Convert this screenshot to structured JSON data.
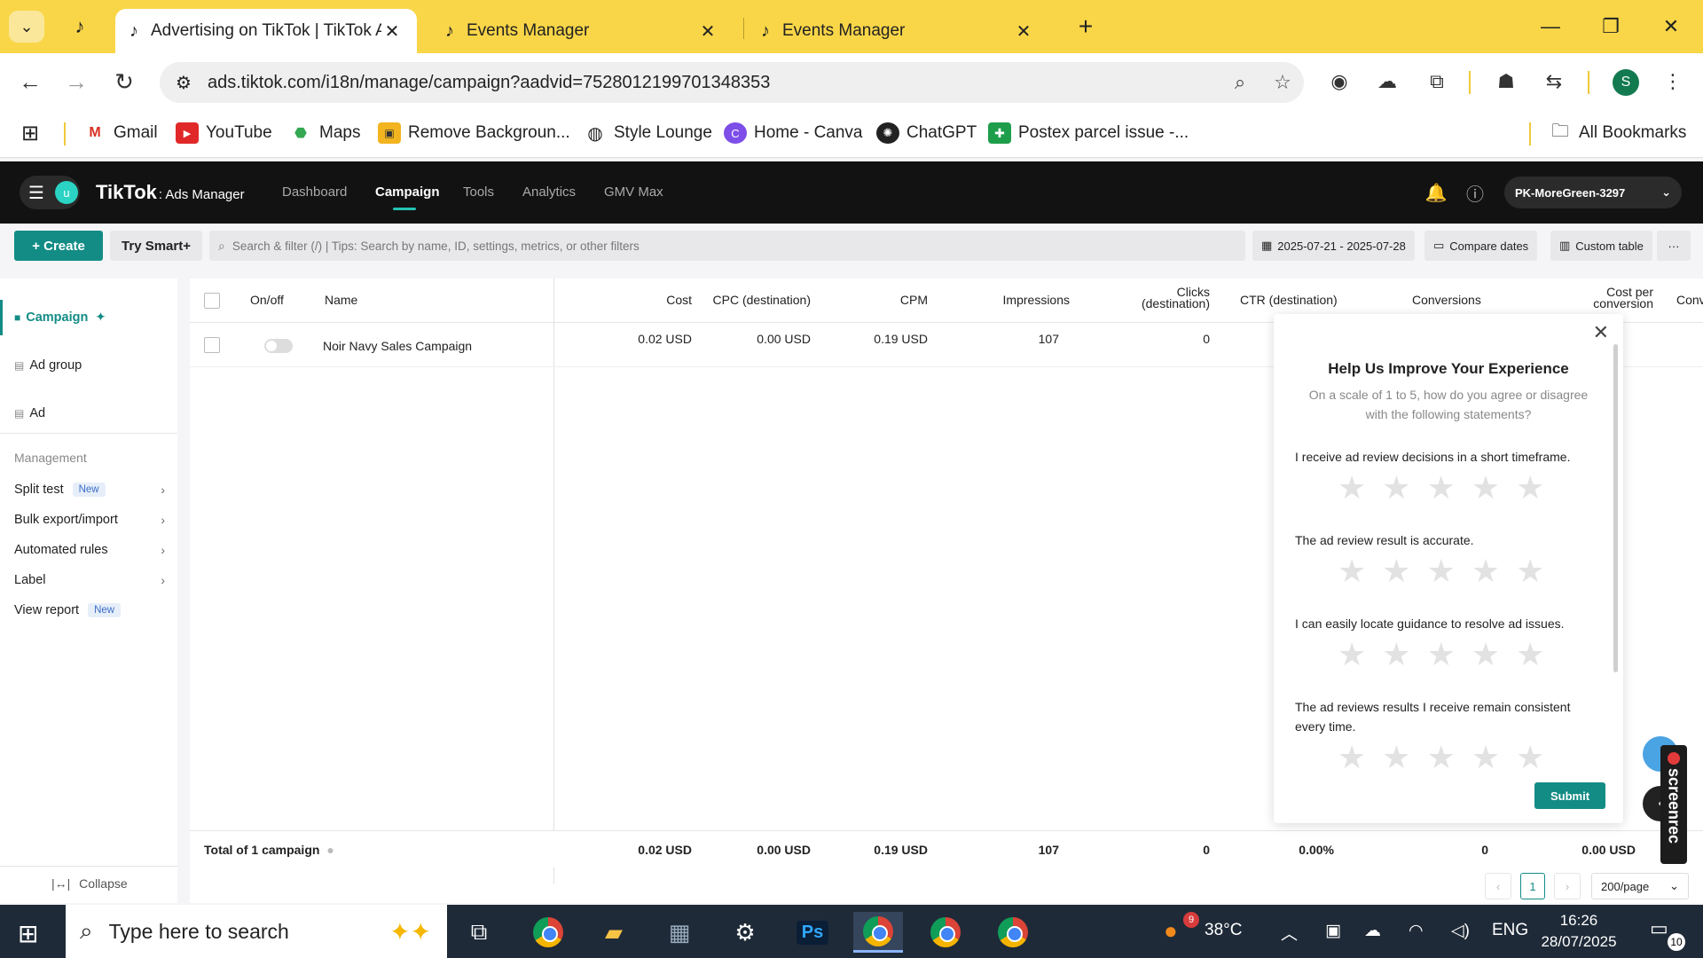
{
  "browser": {
    "tabs": [
      {
        "title": "Advertising on TikTok | TikTok A",
        "active": true
      },
      {
        "title": "Events Manager",
        "active": false
      },
      {
        "title": "Events Manager",
        "active": false
      }
    ],
    "url": "ads.tiktok.com/i18n/manage/campaign?aadvid=7528012199701348353",
    "profile_initial": "S",
    "bookmarks": [
      "Gmail",
      "YouTube",
      "Maps",
      "Remove Backgroun...",
      "Style Lounge",
      "Home - Canva",
      "ChatGPT",
      "Postex parcel issue -..."
    ],
    "all_bookmarks": "All Bookmarks"
  },
  "app": {
    "avatar_initial": "u",
    "brand": "TikTok",
    "brand_sub": ": Ads Manager",
    "nav": [
      "Dashboard",
      "Campaign",
      "Tools",
      "Analytics",
      "GMV Max"
    ],
    "account": "PK-MoreGreen-3297",
    "create_label": "+ Create",
    "smart_label": "Try Smart+",
    "search_placeholder": "Search & filter (/) | Tips: Search by name, ID, settings, metrics, or other filters",
    "date_range": "2025-07-21 - 2025-07-28",
    "compare_label": "Compare dates",
    "custom_table_label": "Custom table",
    "more_label": "···"
  },
  "sidebar": {
    "levels": [
      "Campaign",
      "Ad group",
      "Ad"
    ],
    "management_title": "Management",
    "management": [
      {
        "label": "Split test",
        "badge": "New",
        "chevron": true
      },
      {
        "label": "Bulk export/import",
        "badge": "",
        "chevron": true
      },
      {
        "label": "Automated rules",
        "badge": "",
        "chevron": true
      },
      {
        "label": "Label",
        "badge": "",
        "chevron": true
      },
      {
        "label": "View report",
        "badge": "New",
        "chevron": false
      }
    ],
    "collapse_label": "Collapse"
  },
  "table": {
    "headers": {
      "onoff": "On/off",
      "name": "Name",
      "cost": "Cost",
      "cpc": "CPC (destination)",
      "cpm": "CPM",
      "impressions": "Impressions",
      "clicks_1": "Clicks",
      "clicks_2": "(destination)",
      "ctr": "CTR (destination)",
      "conversions": "Conversions",
      "cpconv_1": "Cost per",
      "cpconv_2": "conversion",
      "conv_cut": "Conv"
    },
    "row": {
      "name": "Noir Navy Sales Campaign",
      "cost": "0.02 USD",
      "cpc": "0.00 USD",
      "cpm": "0.19 USD",
      "impressions": "107",
      "clicks": "0"
    },
    "total": {
      "label": "Total of 1 campaign",
      "cost": "0.02 USD",
      "cpc": "0.00 USD",
      "cpm": "0.19 USD",
      "impressions": "107",
      "clicks": "0",
      "ctr": "0.00%",
      "conversions": "0",
      "cpconv": "0.00 USD"
    },
    "page": "1",
    "per_page": "200/page"
  },
  "survey": {
    "title": "Help Us Improve Your Experience",
    "subtitle": "On a scale of 1 to 5, how do you agree or disagree with the following statements?",
    "questions": [
      "I receive ad review decisions in a short timeframe.",
      "The ad review result is accurate.",
      "I can easily locate guidance to resolve ad issues.",
      "The ad reviews results I receive remain consistent every time."
    ],
    "submit": "Submit"
  },
  "screenrec_label": "screenrec",
  "taskbar": {
    "search_placeholder": "Type here to search",
    "weather": "38°C",
    "weather_badge": "9",
    "language": "ENG",
    "time": "16:26",
    "date": "28/07/2025",
    "notifications": "10"
  },
  "colors": {
    "accent": "#138c85",
    "chrome_frame": "#f9d648",
    "header": "#121212"
  }
}
